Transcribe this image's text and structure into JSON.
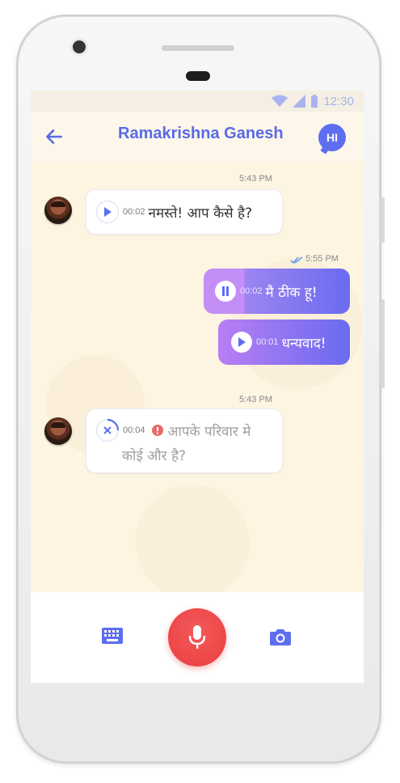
{
  "status": {
    "time": "12:30"
  },
  "header": {
    "back_icon": "arrow-left-icon",
    "title": "Ramakrishna Ganesh",
    "lang_badge": "HI"
  },
  "messages": [
    {
      "side": "in",
      "time": "5:43 PM",
      "duration": "00:02",
      "text": "नमस्ते! आप कैसे है?",
      "control": "play"
    },
    {
      "side": "out",
      "time": "5:55 PM",
      "duration": "00:02",
      "text": "मै ठीक हू!",
      "control": "pause",
      "read": true
    },
    {
      "side": "out",
      "duration": "00:01",
      "text": "धन्यवाद!",
      "control": "play"
    },
    {
      "side": "in",
      "time": "5:43 PM",
      "duration": "00:04",
      "text_line1": "आपके परिवार मे",
      "text_line2": "कोई और है?",
      "control": "cancel",
      "error": true
    }
  ],
  "composer": {
    "keyboard_icon": "keyboard-icon",
    "mic_icon": "microphone-icon",
    "camera_icon": "camera-icon"
  },
  "colors": {
    "accent": "#5d6ff0",
    "bubble_gradient_start": "#b87ef3",
    "bubble_gradient_end": "#6a6bf0",
    "mic_red": "#ea3d40"
  }
}
